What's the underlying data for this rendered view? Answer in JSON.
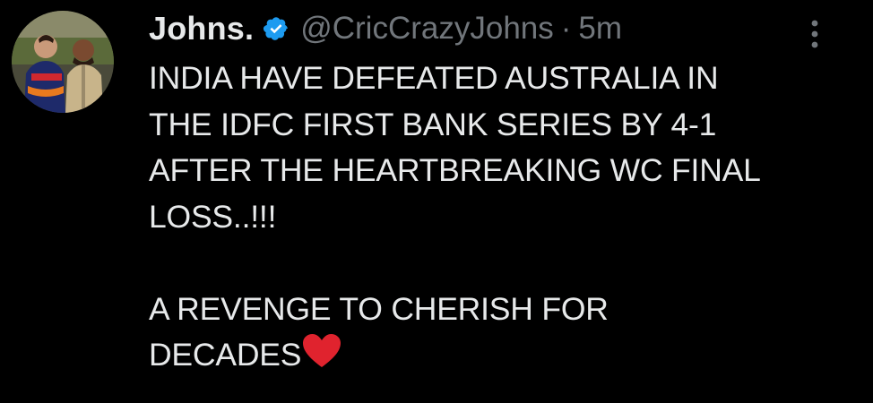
{
  "tweet": {
    "display_name": "Johns.",
    "handle": "@CricCrazyJohns",
    "separator": "·",
    "time": "5m",
    "verified_icon": "verified-badge-icon",
    "more_icon": "more-options-icon",
    "text_lines": [
      "INDIA HAVE DEFEATED AUSTRALIA IN",
      "THE IDFC FIRST BANK SERIES BY 4-1",
      "AFTER THE HEARTBREAKING WC FINAL",
      "LOSS..!!!"
    ],
    "text_lines_2": [
      "A REVENGE TO CHERISH FOR",
      "DECADES"
    ],
    "emoji": "red-heart-icon"
  },
  "colors": {
    "background": "#000000",
    "text": "#e7e9ea",
    "secondary": "#71767b",
    "verified": "#1d9bf0",
    "heart": "#e0232e"
  }
}
